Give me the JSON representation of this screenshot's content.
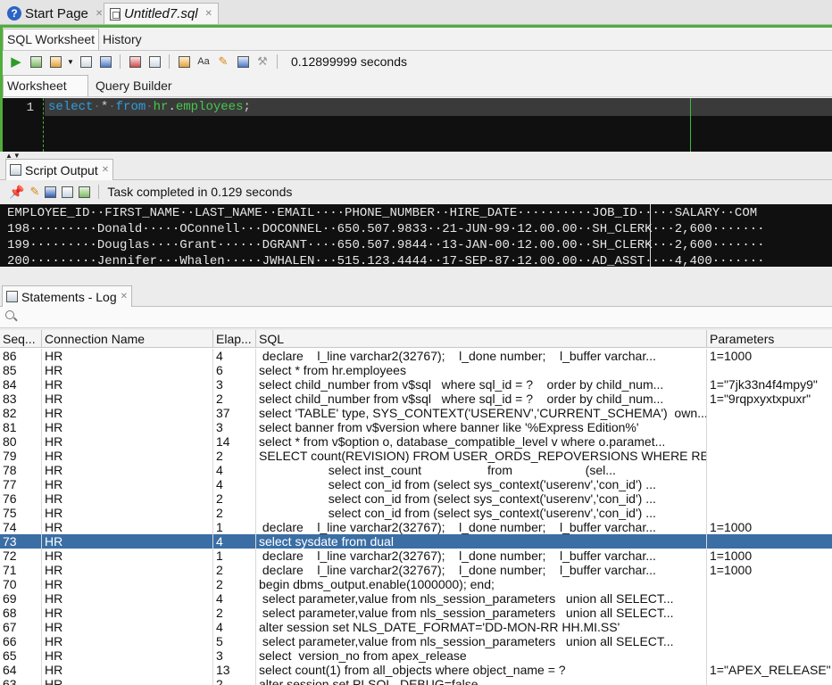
{
  "doc_tabs": [
    {
      "label": "Start Page",
      "icon": "help-icon"
    },
    {
      "label": "Untitled7.sql",
      "icon": "sql-file-icon"
    }
  ],
  "worksheet_tabs": [
    "SQL Worksheet",
    "History"
  ],
  "worksheet_toolbar": {
    "timing": "0.12899999 seconds"
  },
  "editor_tabs": [
    "Worksheet",
    "Query Builder"
  ],
  "editor": {
    "line_number": "1",
    "tokens": [
      "select",
      "*",
      "from",
      "hr",
      ".",
      "employees",
      ";"
    ]
  },
  "script_output": {
    "tab_label": "Script Output",
    "status": "Task completed in 0.129 seconds",
    "header": "EMPLOYEE_ID··FIRST_NAME··LAST_NAME··EMAIL····PHONE_NUMBER··HIRE_DATE··········JOB_ID·····SALARY··COM",
    "rows": [
      "198·········Donald·····OConnell···DOCONNEL··650.507.9833··21-JUN-99·12.00.00··SH_CLERK···2,600·······",
      "199·········Douglas····Grant······DGRANT····650.507.9844··13-JAN-00·12.00.00··SH_CLERK···2,600·······",
      "200·········Jennifer···Whalen·····JWHALEN···515.123.4444··17-SEP-87·12.00.00··AD_ASST····4,400·······"
    ]
  },
  "log": {
    "tab_label": "Statements - Log",
    "columns": [
      "Seq...",
      "Connection Name",
      "Elap...",
      "SQL",
      "Parameters"
    ],
    "selected_seq": "73",
    "rows": [
      [
        "86",
        "HR",
        "4",
        " declare    l_line varchar2(32767);    l_done number;    l_buffer varchar...",
        "1=1000"
      ],
      [
        "85",
        "HR",
        "6",
        "select * from hr.employees",
        ""
      ],
      [
        "84",
        "HR",
        "3",
        "select child_number from v$sql   where sql_id = ?    order by child_num...",
        "1=\"7jk33n4f4mpy9\""
      ],
      [
        "83",
        "HR",
        "2",
        "select child_number from v$sql   where sql_id = ?    order by child_num...",
        "1=\"9rqpxyxtxpuxr\""
      ],
      [
        "82",
        "HR",
        "37",
        "select 'TABLE' type, SYS_CONTEXT('USERENV','CURRENT_SCHEMA')  own...",
        ""
      ],
      [
        "81",
        "HR",
        "3",
        "select banner from v$version where banner like '%Express Edition%'",
        ""
      ],
      [
        "80",
        "HR",
        "14",
        "select * from v$option o, database_compatible_level v where o.paramet...",
        ""
      ],
      [
        "79",
        "HR",
        "2",
        "SELECT count(REVISION) FROM USER_ORDS_REPOVERSIONS WHERE REVI...",
        ""
      ],
      [
        "78",
        "HR",
        "4",
        "                    select inst_count                   from                     (sel...",
        ""
      ],
      [
        "77",
        "HR",
        "4",
        "                    select con_id from (select sys_context('userenv','con_id') ...",
        ""
      ],
      [
        "76",
        "HR",
        "2",
        "                    select con_id from (select sys_context('userenv','con_id') ...",
        ""
      ],
      [
        "75",
        "HR",
        "2",
        "                    select con_id from (select sys_context('userenv','con_id') ...",
        ""
      ],
      [
        "74",
        "HR",
        "1",
        " declare    l_line varchar2(32767);    l_done number;    l_buffer varchar...",
        "1=1000"
      ],
      [
        "73",
        "HR",
        "4",
        "select sysdate from dual",
        ""
      ],
      [
        "72",
        "HR",
        "1",
        " declare    l_line varchar2(32767);    l_done number;    l_buffer varchar...",
        "1=1000"
      ],
      [
        "71",
        "HR",
        "2",
        " declare    l_line varchar2(32767);    l_done number;    l_buffer varchar...",
        "1=1000"
      ],
      [
        "70",
        "HR",
        "2",
        "begin dbms_output.enable(1000000); end;",
        ""
      ],
      [
        "69",
        "HR",
        "4",
        " select parameter,value from nls_session_parameters   union all SELECT...",
        ""
      ],
      [
        "68",
        "HR",
        "2",
        " select parameter,value from nls_session_parameters   union all SELECT...",
        ""
      ],
      [
        "67",
        "HR",
        "4",
        "alter session set NLS_DATE_FORMAT='DD-MON-RR HH.MI.SS'",
        ""
      ],
      [
        "66",
        "HR",
        "5",
        " select parameter,value from nls_session_parameters   union all SELECT...",
        ""
      ],
      [
        "65",
        "HR",
        "3",
        "select  version_no from apex_release",
        ""
      ],
      [
        "64",
        "HR",
        "13",
        "select count(1) from all_objects where object_name = ?",
        "1=\"APEX_RELEASE\""
      ],
      [
        "63",
        "HR",
        "2",
        "alter session set PLSQL_DEBUG=false",
        ""
      ]
    ]
  },
  "colors": {
    "active_border": "#4fae3a",
    "selection": "#3a6ea5",
    "keyword": "#2e9ee0",
    "identifier": "#43c94c"
  }
}
